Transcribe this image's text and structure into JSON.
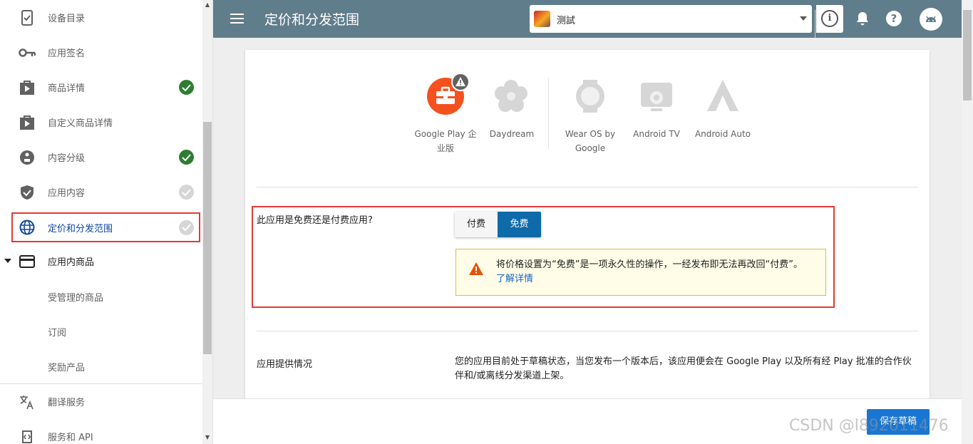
{
  "header": {
    "page_title": "定价和分发范围",
    "app_name": "测試"
  },
  "sidebar": {
    "items": [
      {
        "label": "设备目录",
        "icon": "device-catalog-icon"
      },
      {
        "label": "应用签名",
        "icon": "key-icon"
      },
      {
        "label": "商品详情",
        "icon": "store-listing-icon",
        "status": "done"
      },
      {
        "label": "自定义商品详情",
        "icon": "custom-listing-icon"
      },
      {
        "label": "内容分级",
        "icon": "content-rating-icon",
        "status": "done"
      },
      {
        "label": "应用内容",
        "icon": "shield-icon",
        "status": "pending"
      },
      {
        "label": "定价和分发范围",
        "icon": "globe-icon",
        "status": "pending",
        "active": true
      },
      {
        "label": "应用内商品",
        "icon": "card-icon",
        "expanded": true
      },
      {
        "label": "受管理的商品"
      },
      {
        "label": "订阅"
      },
      {
        "label": "奖励产品"
      },
      {
        "label": "翻译服务",
        "icon": "translate-icon"
      },
      {
        "label": "服务和 API",
        "icon": "api-icon"
      }
    ]
  },
  "platforms": [
    {
      "label": "Google Play 企业版",
      "icon": "briefcase-icon",
      "warning": true
    },
    {
      "label": "Daydream",
      "icon": "daydream-icon"
    },
    {
      "label": "Wear OS by Google",
      "icon": "wear-os-icon"
    },
    {
      "label": "Android TV",
      "icon": "tv-icon"
    },
    {
      "label": "Android Auto",
      "icon": "auto-icon"
    }
  ],
  "pricing": {
    "question": "此应用是免费还是付费应用?",
    "paid_label": "付费",
    "free_label": "免费",
    "selected": "免费",
    "warning_text": "将价格设置为“免费”是一项永久性的操作，一经发布即无法再改回“付费”。",
    "warning_link": "了解详情"
  },
  "availability": {
    "label": "应用提供情况",
    "text": "您的应用目前处于草稿状态，当您发布一个版本后，该应用便会在 Google Play 以及所有经 Play 批准的合作伙伴和/或离线分发渠道上架。"
  },
  "footer": {
    "save_label": "保存草稿",
    "watermark": "CSDN @l892011476"
  },
  "colors": {
    "topbar": "#607d8b",
    "accent": "#1976d2",
    "free_selected": "#0e6aa8",
    "highlight_box": "#e53935",
    "done": "#2e7d32",
    "warning_bg": "#fffde7"
  }
}
